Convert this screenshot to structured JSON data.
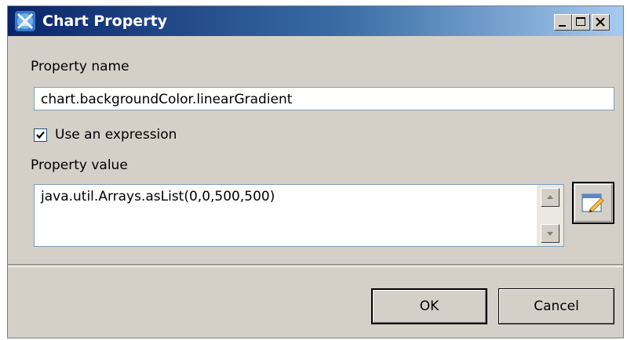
{
  "window": {
    "title": "Chart Property",
    "controls": {
      "minimize_icon": "minimize-icon",
      "maximize_icon": "maximize-icon",
      "close_icon": "close-icon"
    }
  },
  "form": {
    "property_name_label": "Property name",
    "property_name_value": "chart.backgroundColor.linearGradient",
    "use_expression": {
      "label": "Use an expression",
      "checked": true
    },
    "property_value_label": "Property value",
    "property_value_text": "java.util.Arrays.asList(0,0,500,500)"
  },
  "buttons": {
    "ok_label": "OK",
    "cancel_label": "Cancel"
  },
  "colors": {
    "titlebar_start": "#0a246a",
    "titlebar_end": "#a6caf0",
    "dialog_face": "#d4d0c8"
  }
}
